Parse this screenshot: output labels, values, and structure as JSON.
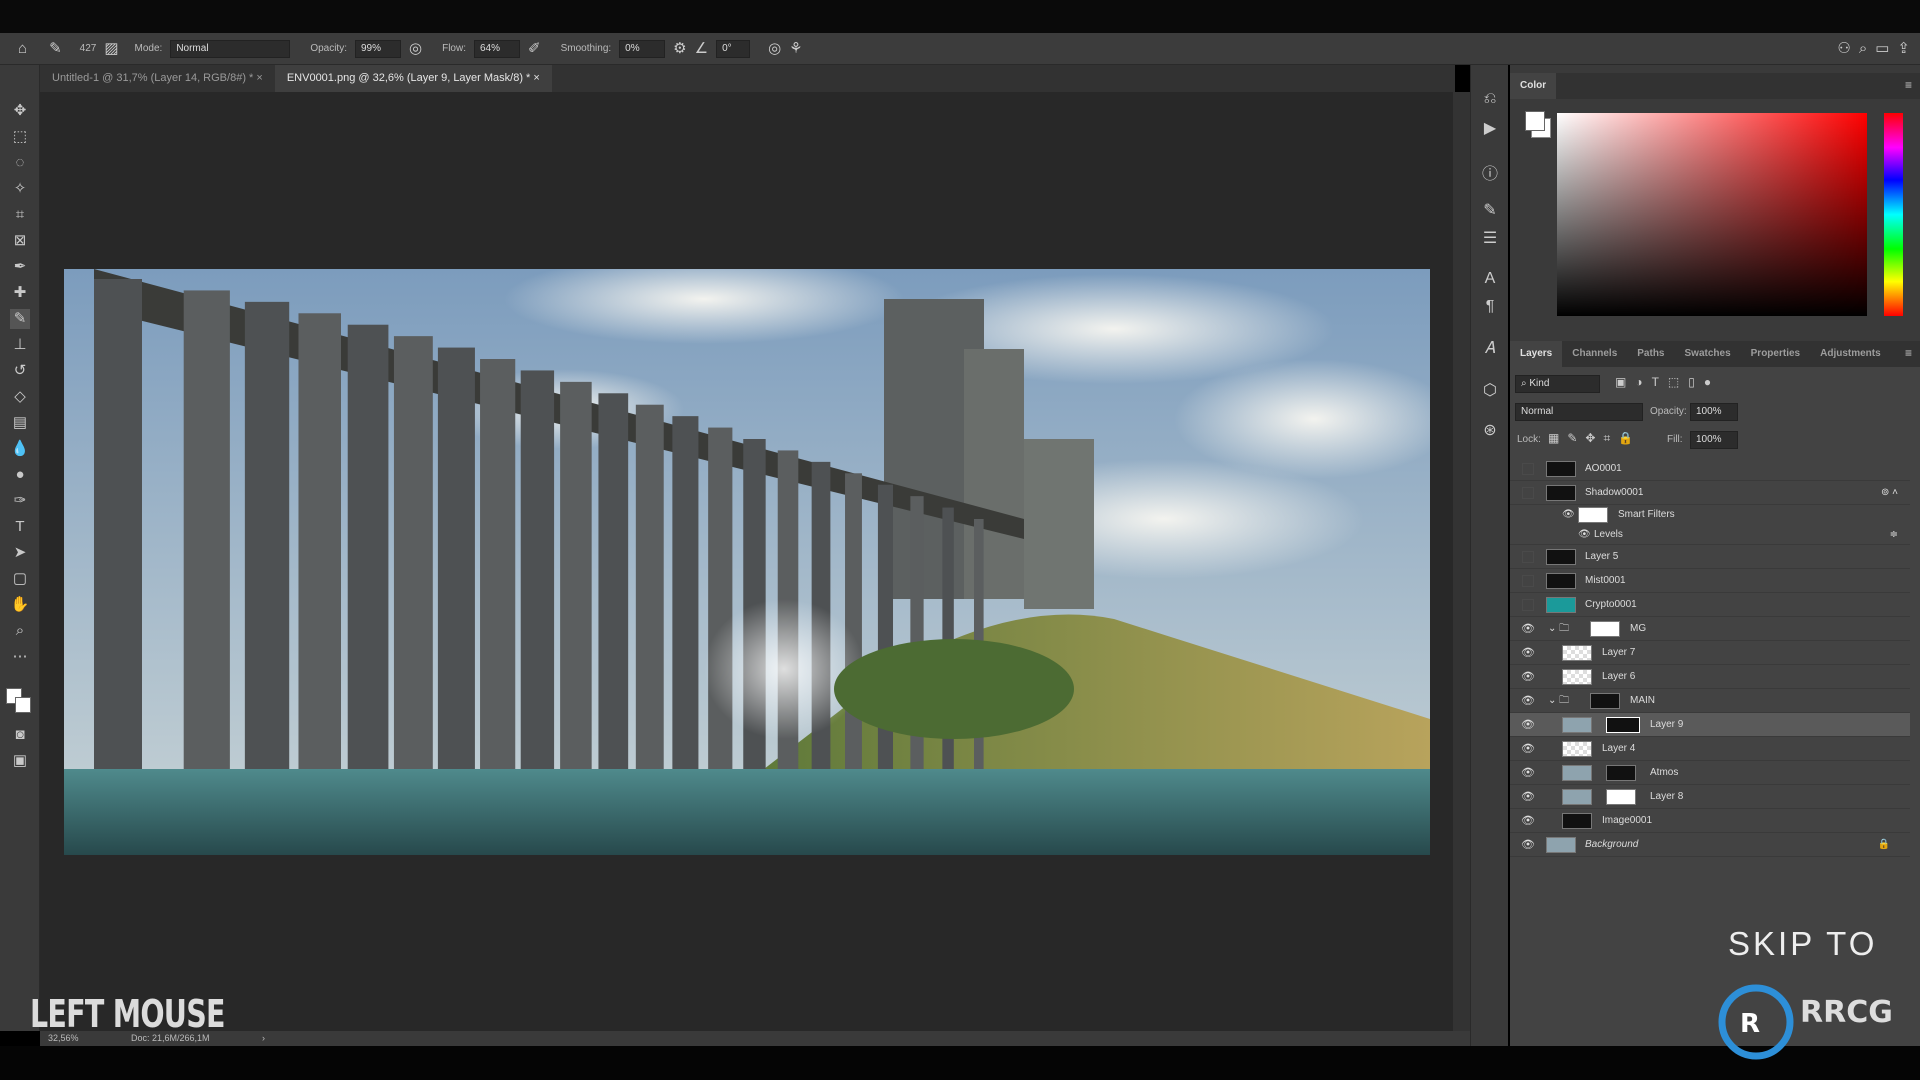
{
  "options_bar": {
    "brush_size": "427",
    "mode_label": "Mode:",
    "mode_value": "Normal",
    "opacity_label": "Opacity:",
    "opacity_value": "99%",
    "flow_label": "Flow:",
    "flow_value": "64%",
    "smoothing_label": "Smoothing:",
    "smoothing_value": "0%",
    "angle_value": "0°"
  },
  "tabs": [
    {
      "label": "Untitled-1 @ 31,7% (Layer 14, RGB/8#) *",
      "active": false
    },
    {
      "label": "ENV0001.png @ 32,6% (Layer 9, Layer Mask/8) *",
      "active": true
    }
  ],
  "status": {
    "zoom": "32,56%",
    "doc": "Doc: 21,6M/266,1M"
  },
  "color_panel": {
    "title": "Color",
    "foreground": "#ffffff",
    "background": "#ffffff",
    "hue": "#ff0000"
  },
  "layers_panel": {
    "tabs": [
      "Layers",
      "Channels",
      "Paths",
      "Swatches",
      "Properties",
      "Adjustments"
    ],
    "filter_kind": "Kind",
    "blend_mode": "Normal",
    "opacity_label": "Opacity:",
    "opacity_value": "100%",
    "lock_label": "Lock:",
    "fill_label": "Fill:",
    "fill_value": "100%",
    "layers": [
      {
        "name": "AO0001",
        "visible": false
      },
      {
        "name": "Shadow0001",
        "visible": false
      },
      {
        "name": "Smart Filters",
        "visible": true
      },
      {
        "name": "Levels",
        "visible": true
      },
      {
        "name": "Layer 5",
        "visible": false
      },
      {
        "name": "Mist0001",
        "visible": false
      },
      {
        "name": "Crypto0001",
        "visible": false
      },
      {
        "name": "MG",
        "visible": true
      },
      {
        "name": "Layer 7",
        "visible": true
      },
      {
        "name": "Layer 6",
        "visible": true
      },
      {
        "name": "MAIN",
        "visible": true
      },
      {
        "name": "Layer 9",
        "visible": true,
        "selected": true
      },
      {
        "name": "Layer 4",
        "visible": true
      },
      {
        "name": "Atmos",
        "visible": true
      },
      {
        "name": "Layer 8",
        "visible": true
      },
      {
        "name": "Image0001",
        "visible": true
      },
      {
        "name": "Background",
        "visible": true,
        "locked": true
      }
    ]
  },
  "overlay": {
    "left_caption": "LEFT MOUSE",
    "skip_caption": "SKIP TO",
    "watermark": "RRCG 人人素材"
  }
}
